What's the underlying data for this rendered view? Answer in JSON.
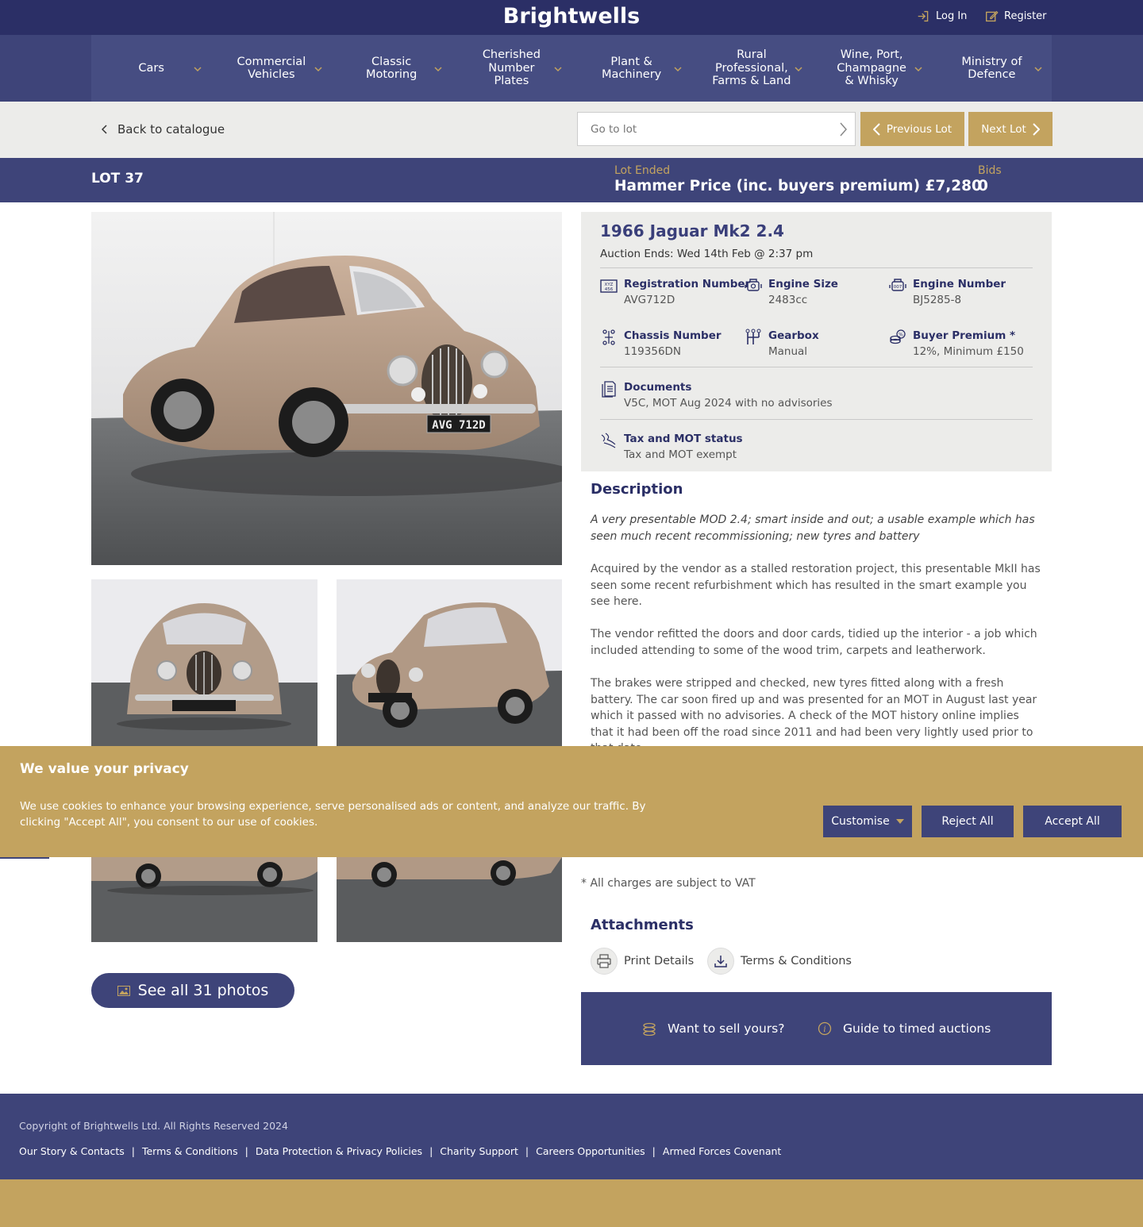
{
  "header": {
    "logo": "Brightwells",
    "login": "Log In",
    "register": "Register"
  },
  "nav": [
    {
      "label": "Cars"
    },
    {
      "label": "Commercial Vehicles"
    },
    {
      "label": "Classic Motoring"
    },
    {
      "label": "Cherished Number Plates"
    },
    {
      "label": "Plant & Machinery"
    },
    {
      "label": "Rural Professional, Farms & Land"
    },
    {
      "label": "Wine, Port, Champagne & Whisky"
    },
    {
      "label": "Ministry of Defence"
    }
  ],
  "subbar": {
    "back": "Back to catalogue",
    "goto_placeholder": "Go to lot",
    "prev": "Previous Lot",
    "next": "Next Lot"
  },
  "lot": {
    "number": "LOT 37",
    "status": "Lot Ended",
    "hammer": "Hammer Price (inc. buyers premium) £7,280",
    "bids_label": "Bids",
    "bids_value": "0"
  },
  "vehicle": {
    "title": "1966 Jaguar Mk2 2.4",
    "auction_ends": "Auction Ends: Wed 14th Feb @ 2:37 pm",
    "specs": [
      {
        "key": "Registration Number",
        "value": "AVG712D",
        "icon": "registration-icon"
      },
      {
        "key": "Engine Size",
        "value": "2483cc",
        "icon": "engine-icon"
      },
      {
        "key": "Engine Number",
        "value": "BJ5285-8",
        "icon": "engine-number-icon"
      },
      {
        "key": "Chassis Number",
        "value": "119356DN",
        "icon": "chassis-icon"
      },
      {
        "key": "Gearbox",
        "value": "Manual",
        "icon": "gearbox-icon"
      },
      {
        "key": "Buyer Premium *",
        "value": "12%, Minimum £150",
        "icon": "coins-icon"
      },
      {
        "key": "Documents",
        "value": "V5C, MOT Aug 2024 with no advisories",
        "icon": "documents-icon"
      },
      {
        "key": "Tax and MOT status",
        "value": "Tax and MOT exempt",
        "icon": "tax-icon"
      }
    ],
    "plate_text": "AVG 712D"
  },
  "description": {
    "heading": "Description",
    "summary": "A very presentable MOD 2.4; smart inside and out; a usable example which has seen much recent recommissioning; new tyres and battery",
    "p1": "Acquired by the vendor as a stalled restoration project, this presentable MkII has seen some recent refurbishment which has resulted in the smart example you see here.",
    "p2": "The vendor refitted the doors and door cards, tidied up the interior - a job which included attending to some of the wood trim, carpets and leatherwork.",
    "p3": "The brakes were stripped and checked, new tyres fitted along with a fresh battery. The car soon fired up and was presented for an MOT in August last year which it passed with no advisories. A check of the MOT history online implies that it had been off the road since 2011 and had been very lightly used prior to that date."
  },
  "vat_note": "* All charges are subject to VAT",
  "attachments": {
    "heading": "Attachments",
    "print": "Print Details",
    "terms": "Terms & Conditions"
  },
  "sell": {
    "want": "Want to sell yours?",
    "guide": "Guide to timed auctions"
  },
  "photos": {
    "see_all": "See all 31 photos"
  },
  "footer": {
    "copyright": "Copyright of Brightwells Ltd. All Rights Reserved 2024",
    "links": [
      "Our Story & Contacts",
      "Terms & Conditions",
      "Data Protection & Privacy Policies",
      "Charity Support",
      "Careers Opportunities",
      "Armed Forces Covenant"
    ]
  },
  "cookie": {
    "heading": "We value your privacy",
    "text": "We use cookies to enhance your browsing experience, serve personalised ads or content, and analyze our traffic. By clicking \"Accept All\", you consent to our use of cookies.",
    "customise": "Customise",
    "reject": "Reject All",
    "accept": "Accept All"
  },
  "colors": {
    "navy": "#2b2f66",
    "nav": "#3e4479",
    "gold": "#c3a35f",
    "panel": "#ececea"
  }
}
